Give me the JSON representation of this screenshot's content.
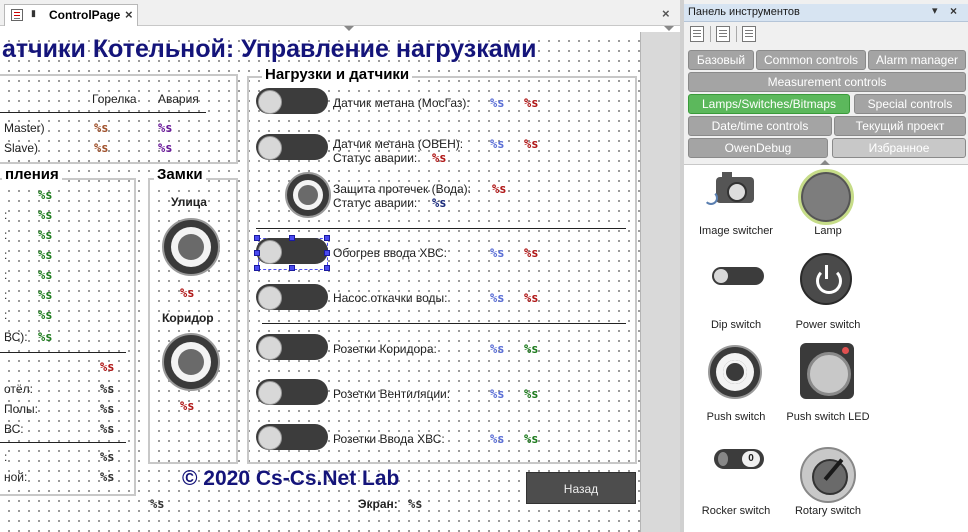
{
  "editor": {
    "tab_label": "ControlPage",
    "tab_close": "×",
    "close": "×"
  },
  "page": {
    "title": "атчики Котельной: Управление нагрузками",
    "copyright": "© 2020 Cs-Cs.Net Lab",
    "back_button": "Назад",
    "screen_label": "Экран:",
    "screen_value": "%s",
    "bottom_left_value": "%s"
  },
  "left_group": {
    "col_burner": "Горелка",
    "col_alarm": "Авария",
    "row1": "Master)",
    "row2": "Slave)",
    "row1_v1": "%s",
    "row1_v2": "%s",
    "row2_v1": "%s",
    "row2_v2": "%s"
  },
  "heating_group": {
    "title": "пления",
    "values": [
      "%s",
      "%s",
      "%s",
      "%s",
      "%s",
      "%s",
      "%s",
      "%s"
    ],
    "row_labels": [
      ":",
      ":",
      ":",
      ":",
      ":",
      ":",
      "ВС):"
    ],
    "lower_values": [
      "%s",
      "%s",
      "%s",
      "%s",
      "%s",
      "%s",
      "%s"
    ],
    "lower_labels": [
      "",
      "отёл:",
      "Полы:",
      "ВС:",
      "",
      ":",
      "ной:"
    ]
  },
  "locks_group": {
    "title": "Замки",
    "street": "Улица",
    "street_value": "%s",
    "corridor": "Коридор",
    "corridor_value": "%s"
  },
  "loads_group": {
    "title": "Нагрузки и датчики",
    "rows": [
      {
        "label": "Датчик метана (МосГаз):",
        "v1": "%s",
        "v2": "%s"
      },
      {
        "label": "Датчик метана (ОВЕН):",
        "v1": "%s",
        "v2": "%s",
        "label2": "Статус аварии:",
        "v3": "%s"
      },
      {
        "label": "Защита протечек (Вода):",
        "v2": "%s",
        "label2": "Статус аварии:",
        "v3": "%s"
      },
      {
        "label": "Обогрев ввода ХВС:",
        "v1": "%s",
        "v2": "%s"
      },
      {
        "label": "Насос откачки воды:",
        "v1": "%s",
        "v2": "%s"
      },
      {
        "label": "Розетки Коридора:",
        "v1": "%s",
        "v2": "%s"
      },
      {
        "label": "Розетки Вентиляции:",
        "v1": "%s",
        "v2": "%s"
      },
      {
        "label": "Розетки Ввода ХВС:",
        "v1": "%s",
        "v2": "%s"
      }
    ]
  },
  "toolbox": {
    "title": "Панель инструментов",
    "pin": "▾",
    "close": "×",
    "categories": [
      "Базовый",
      "Common controls",
      "Alarm manager",
      "Measurement controls",
      "Lamps/Switches/Bitmaps",
      "Special controls",
      "Date/time controls",
      "Текущий проект",
      "OwenDebug",
      "Избранное"
    ],
    "tools": [
      "Image switcher",
      "Lamp",
      "Dip switch",
      "Power switch",
      "Push switch",
      "Push switch LED",
      "Rocker switch",
      "Rotary switch"
    ],
    "rocker_on": "0"
  },
  "colors": {
    "title_blue": "#14147a",
    "active_category": "#5cb85c",
    "category_gray": "#a4a4a4",
    "panel_header": "#d7e4f2"
  }
}
